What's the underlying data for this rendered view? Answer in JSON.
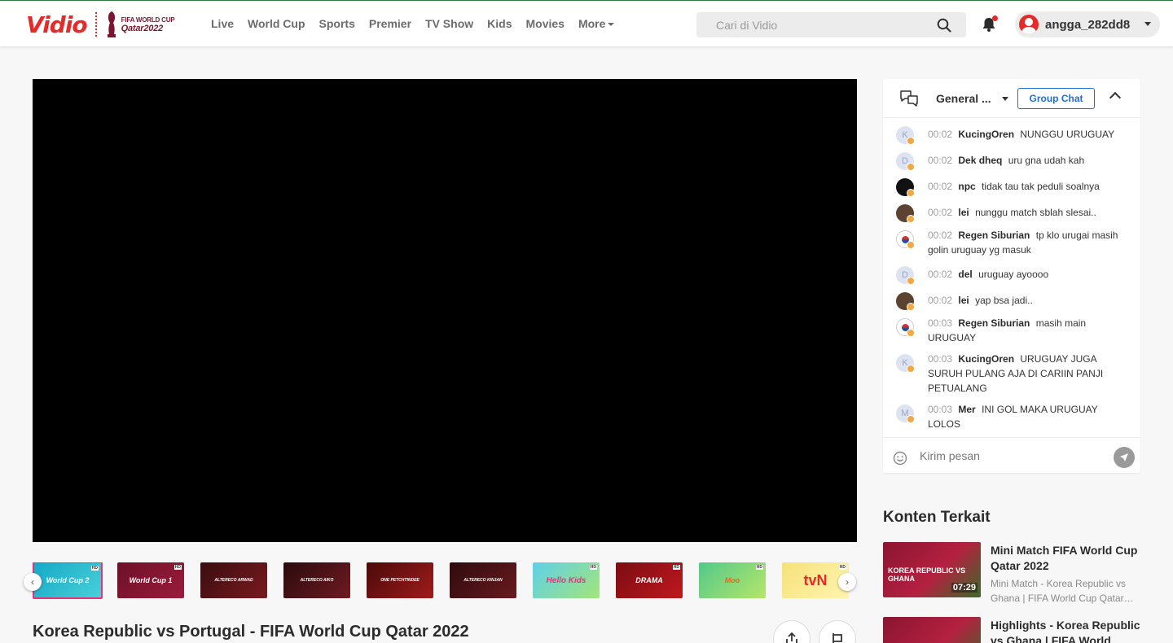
{
  "header": {
    "logo_text": "Vidio",
    "wc_logo": {
      "line1": "FIFA WORLD CUP",
      "line2": "Qatar2022"
    },
    "nav": [
      "Live",
      "World Cup",
      "Sports",
      "Premier",
      "TV Show",
      "Kids",
      "Movies",
      "More"
    ],
    "search_placeholder": "Cari di Vidio",
    "username": "angga_282dd8",
    "notification_dot": true
  },
  "player": {
    "state": "black"
  },
  "channels": [
    {
      "label": "World Cup 2",
      "active": true,
      "hd": true
    },
    {
      "label": "World Cup 1",
      "active": false,
      "hd": true
    },
    {
      "label": "ALTERECO ARWAD",
      "active": false,
      "hd": false
    },
    {
      "label": "ALTERECO AIKO",
      "active": false,
      "hd": false
    },
    {
      "label": "ONE PETCHTINDEE",
      "active": false,
      "hd": false
    },
    {
      "label": "ALTERECO KINJAN",
      "active": false,
      "hd": false
    },
    {
      "label": "Hello Kids",
      "active": false,
      "hd": true
    },
    {
      "label": "DRAMA",
      "active": false,
      "hd": true
    },
    {
      "label": "Moo",
      "active": false,
      "hd": true
    },
    {
      "label": "tvN",
      "active": false,
      "hd": true
    }
  ],
  "video_title": "Korea Republic vs Portugal - FIFA World Cup Qatar 2022",
  "chat": {
    "room": "General ...",
    "group_button": "Group Chat",
    "messages": [
      {
        "initial": "K",
        "time": "00:02",
        "user": "KucingOren",
        "text": "NUNGGU URUGUAY",
        "avatar": "letter"
      },
      {
        "initial": "D",
        "time": "00:02",
        "user": "Dek dheq",
        "text": "uru gna udah kah",
        "avatar": "letter"
      },
      {
        "initial": "",
        "time": "00:02",
        "user": "npc",
        "text": "tidak tau tak peduli soalnya",
        "avatar": "dark"
      },
      {
        "initial": "",
        "time": "00:02",
        "user": "lei",
        "text": "nunggu match sblah slesai..",
        "avatar": "brown"
      },
      {
        "initial": "",
        "time": "00:02",
        "user": "Regen Siburian",
        "text": "tp klo urugai masih golin uruguay yg masuk",
        "avatar": "korea"
      },
      {
        "initial": "D",
        "time": "00:02",
        "user": "del",
        "text": "uruguay ayoooo",
        "avatar": "letter"
      },
      {
        "initial": "",
        "time": "00:02",
        "user": "lei",
        "text": "yap bsa jadi..",
        "avatar": "brown"
      },
      {
        "initial": "",
        "time": "00:03",
        "user": "Regen Siburian",
        "text": "masih main URUGUAY",
        "avatar": "korea"
      },
      {
        "initial": "K",
        "time": "00:03",
        "user": "KucingOren",
        "text": "URUGUAY JUGA SURUH PULANG AJA DI CARIIN PANJI PETUALANG",
        "avatar": "letter"
      },
      {
        "initial": "M",
        "time": "00:03",
        "user": "Mer",
        "text": "INI GOL MAKA URUGUAY LOLOS",
        "avatar": "letter"
      }
    ],
    "input_placeholder": "Kirim pesan"
  },
  "related": {
    "title": "Konten Terkait",
    "items": [
      {
        "title": "Mini Match FIFA World Cup Qatar 2022",
        "desc": "Mini Match - Korea Republic vs Ghana | FIFA World Cup Qatar…",
        "thumb_text": "KOREA REPUBLIC VS GHANA",
        "duration": "07:29"
      },
      {
        "title": "Highlights - Korea Republic vs Ghana | FIFA World Cu…",
        "desc": "",
        "thumb_text": "",
        "duration": ""
      }
    ]
  },
  "colors": {
    "brand": "#e52a2a",
    "accent_blue": "#1e6fd9",
    "wc_maroon": "#7a1631",
    "active_thumb": "#e5337a"
  }
}
